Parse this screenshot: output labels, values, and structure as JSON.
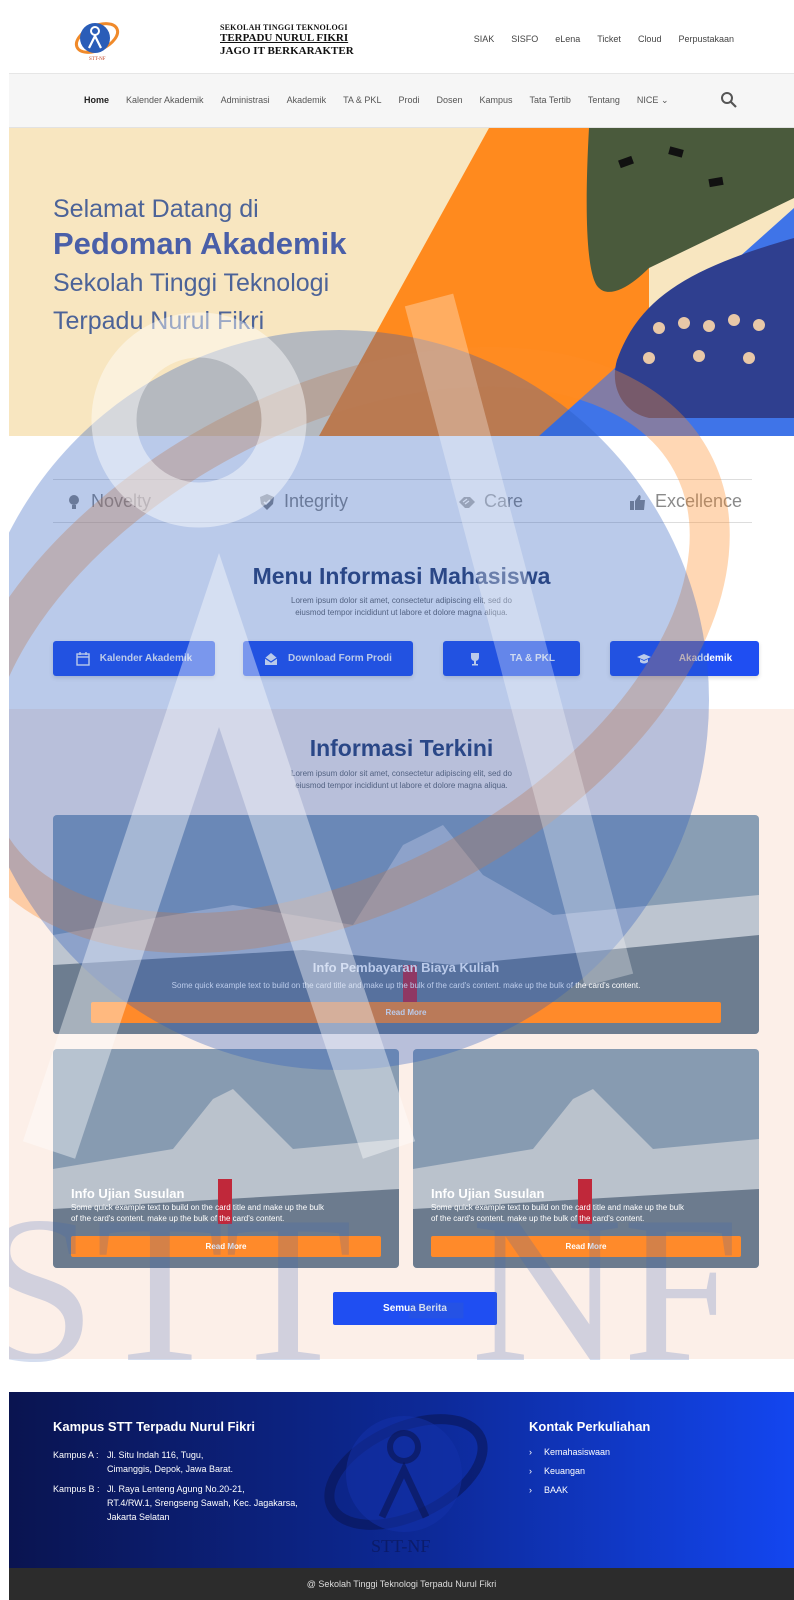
{
  "header": {
    "brand_line1": "SEKOLAH TINGGI TEKNOLOGI",
    "brand_line2": "TERPADU NURUL FIKRI",
    "brand_line3": "JAGO IT BERKARAKTER",
    "logo_text": "STT-NF",
    "links": [
      "SIAK",
      "SISFO",
      "eLena",
      "Ticket",
      "Cloud",
      "Perpustakaan"
    ]
  },
  "nav": {
    "items": [
      "Home",
      "Kalender Akademik",
      "Administrasi",
      "Akademik",
      "TA & PKL",
      "Prodi",
      "Dosen",
      "Kampus",
      "Tata Tertib",
      "Tentang",
      "NICE"
    ],
    "active": "Home"
  },
  "hero": {
    "line1": "Selamat Datang di",
    "line2": "Pedoman Akademik",
    "line3": "Sekolah Tinggi Teknologi",
    "line4": "Terpadu Nurul Fikri"
  },
  "values": [
    {
      "label": "Novelty",
      "icon": "lightbulb-icon"
    },
    {
      "label": "Integrity",
      "icon": "shield-icon"
    },
    {
      "label": "Care",
      "icon": "handshake-icon"
    },
    {
      "label": "Excellence",
      "icon": "thumbs-up-icon"
    }
  ],
  "menu_info": {
    "title": "Menu Informasi Mahasiswa",
    "subtitle_line1": "Lorem ipsum dolor sit amet, consectetur adipiscing elit, sed do",
    "subtitle_line2": "eiusmod tempor incididunt ut labore et dolore magna aliqua.",
    "buttons": [
      {
        "label": "Kalender Akademik",
        "icon": "calendar-icon"
      },
      {
        "label": "Download Form Prodi",
        "icon": "envelope-open-icon"
      },
      {
        "label": "TA & PKL",
        "icon": "trophy-icon"
      },
      {
        "label": "Akaddemik",
        "icon": "graduation-cap-icon"
      }
    ]
  },
  "news": {
    "title": "Informasi Terkini",
    "subtitle_line1": "Lorem ipsum dolor sit amet, consectetur adipiscing elit, sed do",
    "subtitle_line2": "eiusmod tempor incididunt ut labore et dolore magna aliqua.",
    "featured": {
      "title": "Info Pembayaran Biaya Kuliah",
      "text": "Some quick example text to build on the card title and make up the bulk of the card's content. make up the bulk of the card's content.",
      "button": "Read More"
    },
    "cards": [
      {
        "title": "Info Ujian Susulan",
        "text_line1": "Some quick example text to build on the card title and make up the bulk",
        "text_line2": "of the card's content.  make up the bulk of the card's content.",
        "button": "Read More"
      },
      {
        "title": "Info Ujian Susulan",
        "text_line1": "Some quick example text to build on the card title and make up the bulk",
        "text_line2": "of the card's content.  make up the bulk of the card's content.",
        "button": "Read More"
      }
    ],
    "all_button": "Semua Berita"
  },
  "watermark_text": "STT -NF",
  "footer": {
    "campus_title": "Kampus STT Terpadu Nurul Fikri",
    "campus_a_label": "Kampus A :",
    "campus_a_line1": "Jl. Situ Indah 116, Tugu,",
    "campus_a_line2": "Cimanggis, Depok, Jawa Barat.",
    "campus_b_label": "Kampus B :",
    "campus_b_line1": "Jl. Raya Lenteng Agung No.20-21,",
    "campus_b_line2": "RT.4/RW.1, Srengseng Sawah, Kec. Jagakarsa,",
    "campus_b_line3": "Jakarta Selatan",
    "logo_text": "STT-NF",
    "contact_title": "Kontak Perkuliahan",
    "contacts": [
      "Kemahasiswaan",
      "Keuangan",
      "BAAK"
    ],
    "copyright": "@ Sekolah Tinggi Teknologi Terpadu Nurul Fikri"
  },
  "colors": {
    "primary_blue": "#1f4ef2",
    "accent_orange": "#ff8a2a",
    "hero_bg": "#f8e6c0",
    "title_navy": "#2b3f6e"
  }
}
